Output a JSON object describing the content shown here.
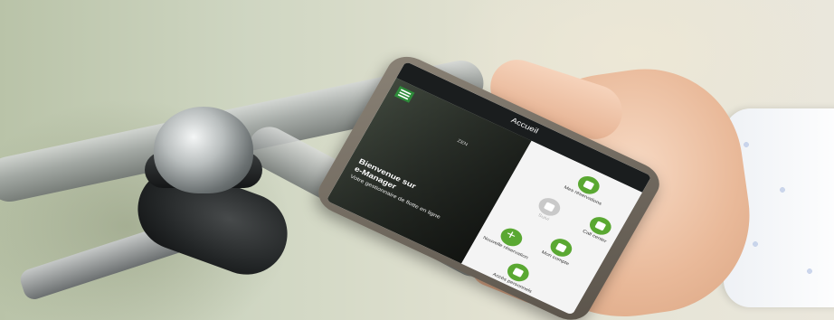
{
  "phone_app": {
    "title": "Accueil",
    "hero": {
      "title_line1": "Bienvenue sur",
      "title_line2": "e-Manager",
      "subtitle": "Votre gestionnaire de flotte en ligne",
      "tag": "ZEN"
    },
    "tiles": [
      {
        "label": "Nouvelle réservation",
        "icon": "plus-icon",
        "state": "active"
      },
      {
        "label": "Suivi",
        "icon": "vehicle-icon",
        "state": "disabled"
      },
      {
        "label": "Mes réservations",
        "icon": "calendar-icon",
        "state": "active"
      },
      {
        "label": "Accès personnels",
        "icon": "user-card-icon",
        "state": "active"
      },
      {
        "label": "Mon compte",
        "icon": "account-icon",
        "state": "active"
      },
      {
        "label": "Call center",
        "icon": "phone-icon",
        "state": "active"
      }
    ],
    "accent_color": "#5aa832"
  }
}
